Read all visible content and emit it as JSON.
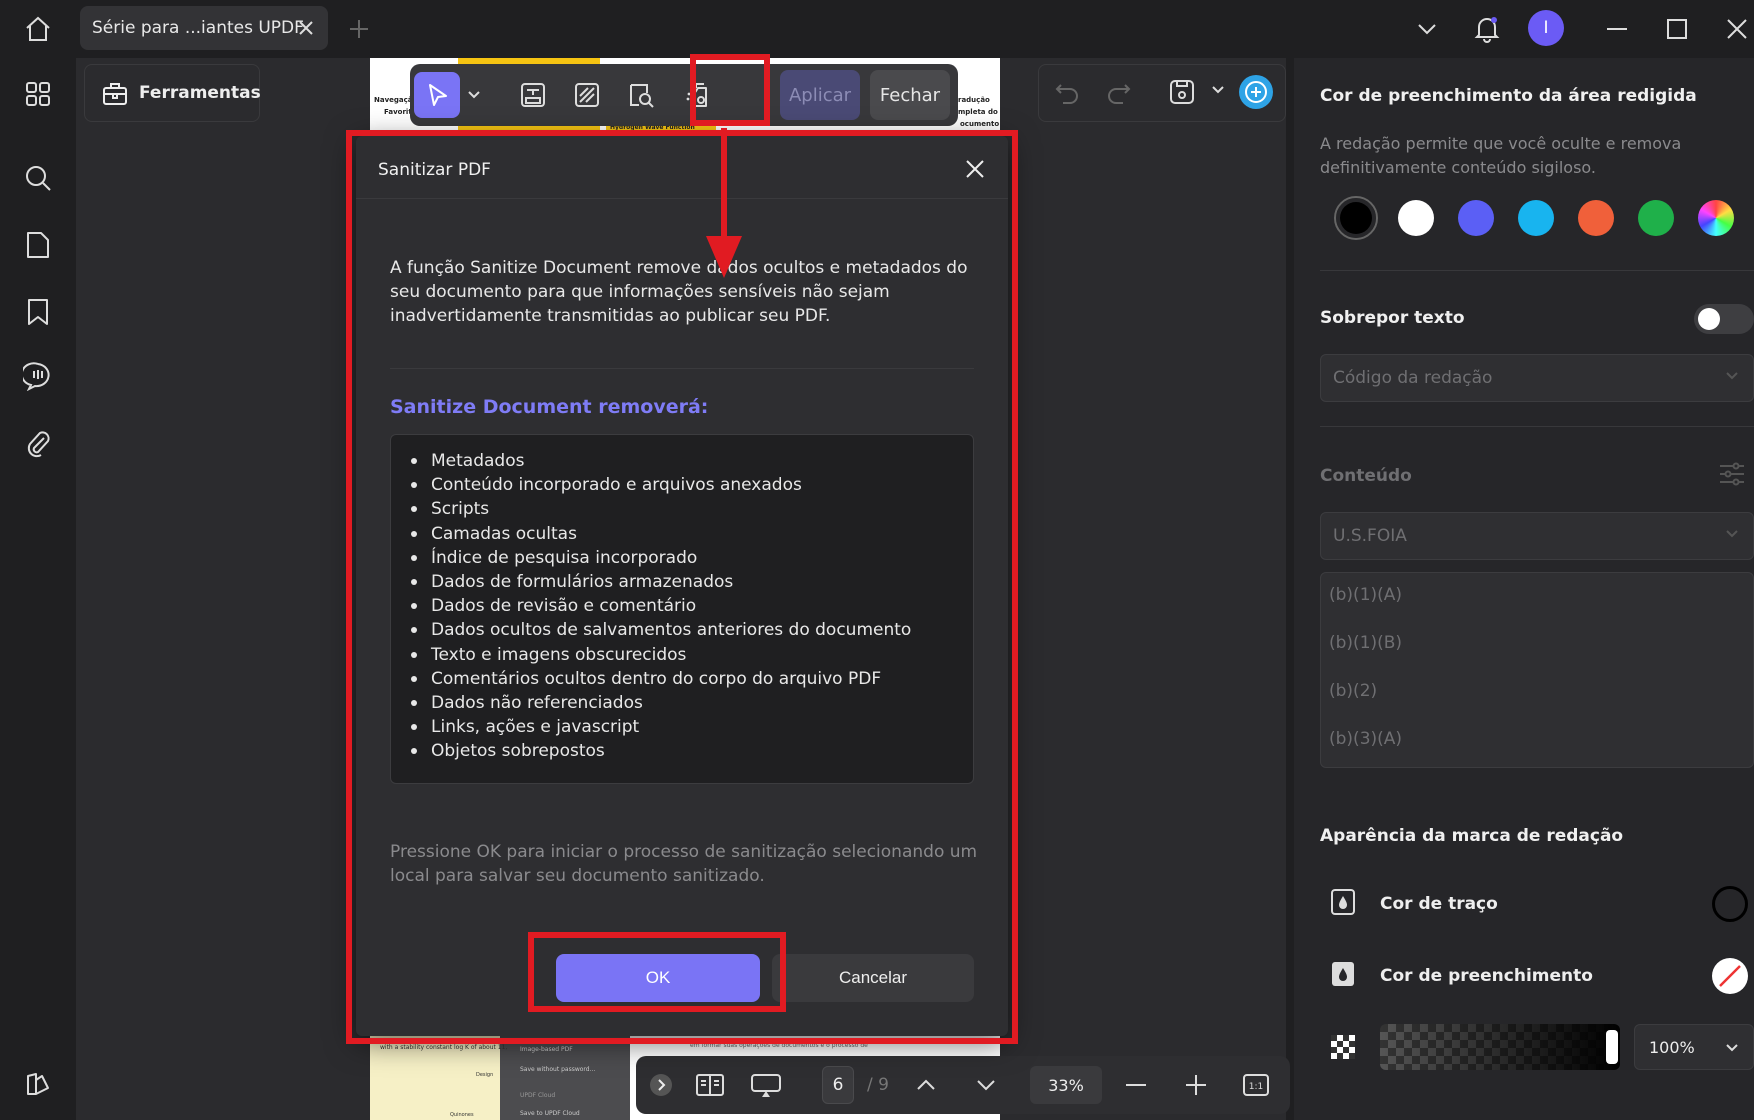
{
  "titlebar": {
    "tab_label": "Série para ...iantes UPDF",
    "avatar_letter": "I"
  },
  "toolbar": {
    "tools_label": "Ferramentas",
    "apply_label": "Aplicar",
    "close_label": "Fechar"
  },
  "page_previews": {
    "top_left_label_1": "Navegaçã",
    "top_left_label_2": "Favorit",
    "top_mid_label": "Hydrogen Wave Function",
    "top_right_label_1": "radução",
    "top_right_label_2": "mpleta do",
    "top_right_label_3": "ocumento",
    "bottom_left_text": "with a stability constant log K of about 11,",
    "bottom_menu_1": "Image-based PDF",
    "bottom_menu_2": "Save without password...",
    "bottom_menu_3": "UPDF Cloud",
    "bottom_menu_4": "Save to UPDF Cloud",
    "bottom_side_1": "Design",
    "bottom_side_2": "Quinones",
    "bottom_right_text": "em formar suas operações de documentos e o processo de"
  },
  "bottom_bar": {
    "page_number": "6",
    "page_total": "/ 9",
    "zoom": "33%"
  },
  "right_panel": {
    "fill_title": "Cor de preenchimento da área redigida",
    "fill_desc": "A redação permite que você oculte e remova definitivamente conteúdo sigiloso.",
    "swatches": [
      "#000000",
      "#ffffff",
      "#5b5ff5",
      "#18b4ef",
      "#f0603a",
      "#1fb04a",
      "rainbow"
    ],
    "overlay_title": "Sobrepor texto",
    "overlay_select": "Código da redação",
    "content_title": "Conteúdo",
    "content_select": "U.S.FOIA",
    "codes": [
      "(b)(1)(A)",
      "(b)(1)(B)",
      "(b)(2)",
      "(b)(3)(A)"
    ],
    "appearance_title": "Aparência da marca de redação",
    "stroke_label": "Cor de traço",
    "fill_label": "Cor de preenchimento",
    "opacity": "100%"
  },
  "dialog": {
    "title": "Sanitizar PDF",
    "description": "A função Sanitize Document remove dados ocultos e metadados do seu documento para que informações sensíveis não sejam inadvertidamente transmitidas ao publicar seu PDF.",
    "remove_title": "Sanitize Document removerá:",
    "items": [
      "Metadados",
      "Conteúdo incorporado e arquivos anexados",
      "Scripts",
      "Camadas ocultas",
      "Índice de pesquisa incorporado",
      "Dados de formulários armazenados",
      "Dados de revisão e comentário",
      "Dados ocultos de salvamentos anteriores do documento",
      "Texto e imagens obscurecidos",
      "Comentários ocultos dentro do corpo do arquivo PDF",
      "Dados não referenciados",
      "Links, ações e javascript",
      "Objetos sobrepostos"
    ],
    "note": "Pressione OK para iniciar o processo de sanitização selecionando um local para salvar seu documento sanitizado.",
    "ok_label": "OK",
    "cancel_label": "Cancelar"
  },
  "colors": {
    "accent": "#7a74f5",
    "annotation_red": "#e11b22"
  }
}
